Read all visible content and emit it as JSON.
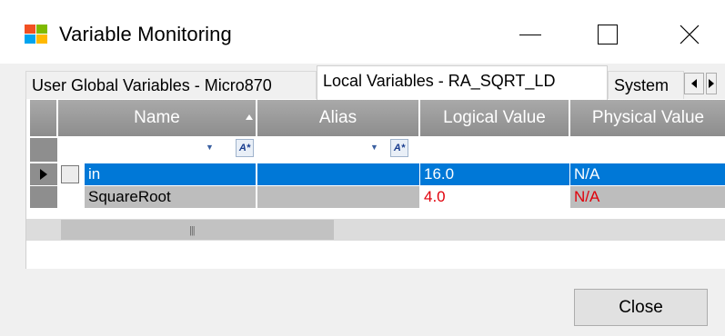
{
  "window": {
    "title": "Variable Monitoring",
    "controls": {
      "minimize": "minimize",
      "maximize": "maximize",
      "close": "close"
    }
  },
  "tabs": [
    {
      "label": "User Global Variables - Micro870",
      "active": false
    },
    {
      "label": "Local Variables - RA_SQRT_LD",
      "active": true
    },
    {
      "label": "System",
      "active": false
    }
  ],
  "grid": {
    "columns": [
      "Name",
      "Alias",
      "Logical Value",
      "Physical Value"
    ],
    "rows": [
      {
        "name": "in",
        "alias": "",
        "logical": "16.0",
        "physical": "N/A",
        "selected": true,
        "has_checkbox": true
      },
      {
        "name": "SquareRoot",
        "alias": "",
        "logical": "4.0",
        "physical": "N/A",
        "selected": false,
        "has_checkbox": false
      }
    ],
    "scroll_position": 0
  },
  "buttons": {
    "close": "Close"
  },
  "colors": {
    "selection": "#0078d7",
    "readonly_cell": "#bdbdbd",
    "alert_text": "#e0000b",
    "header": "#999999"
  }
}
